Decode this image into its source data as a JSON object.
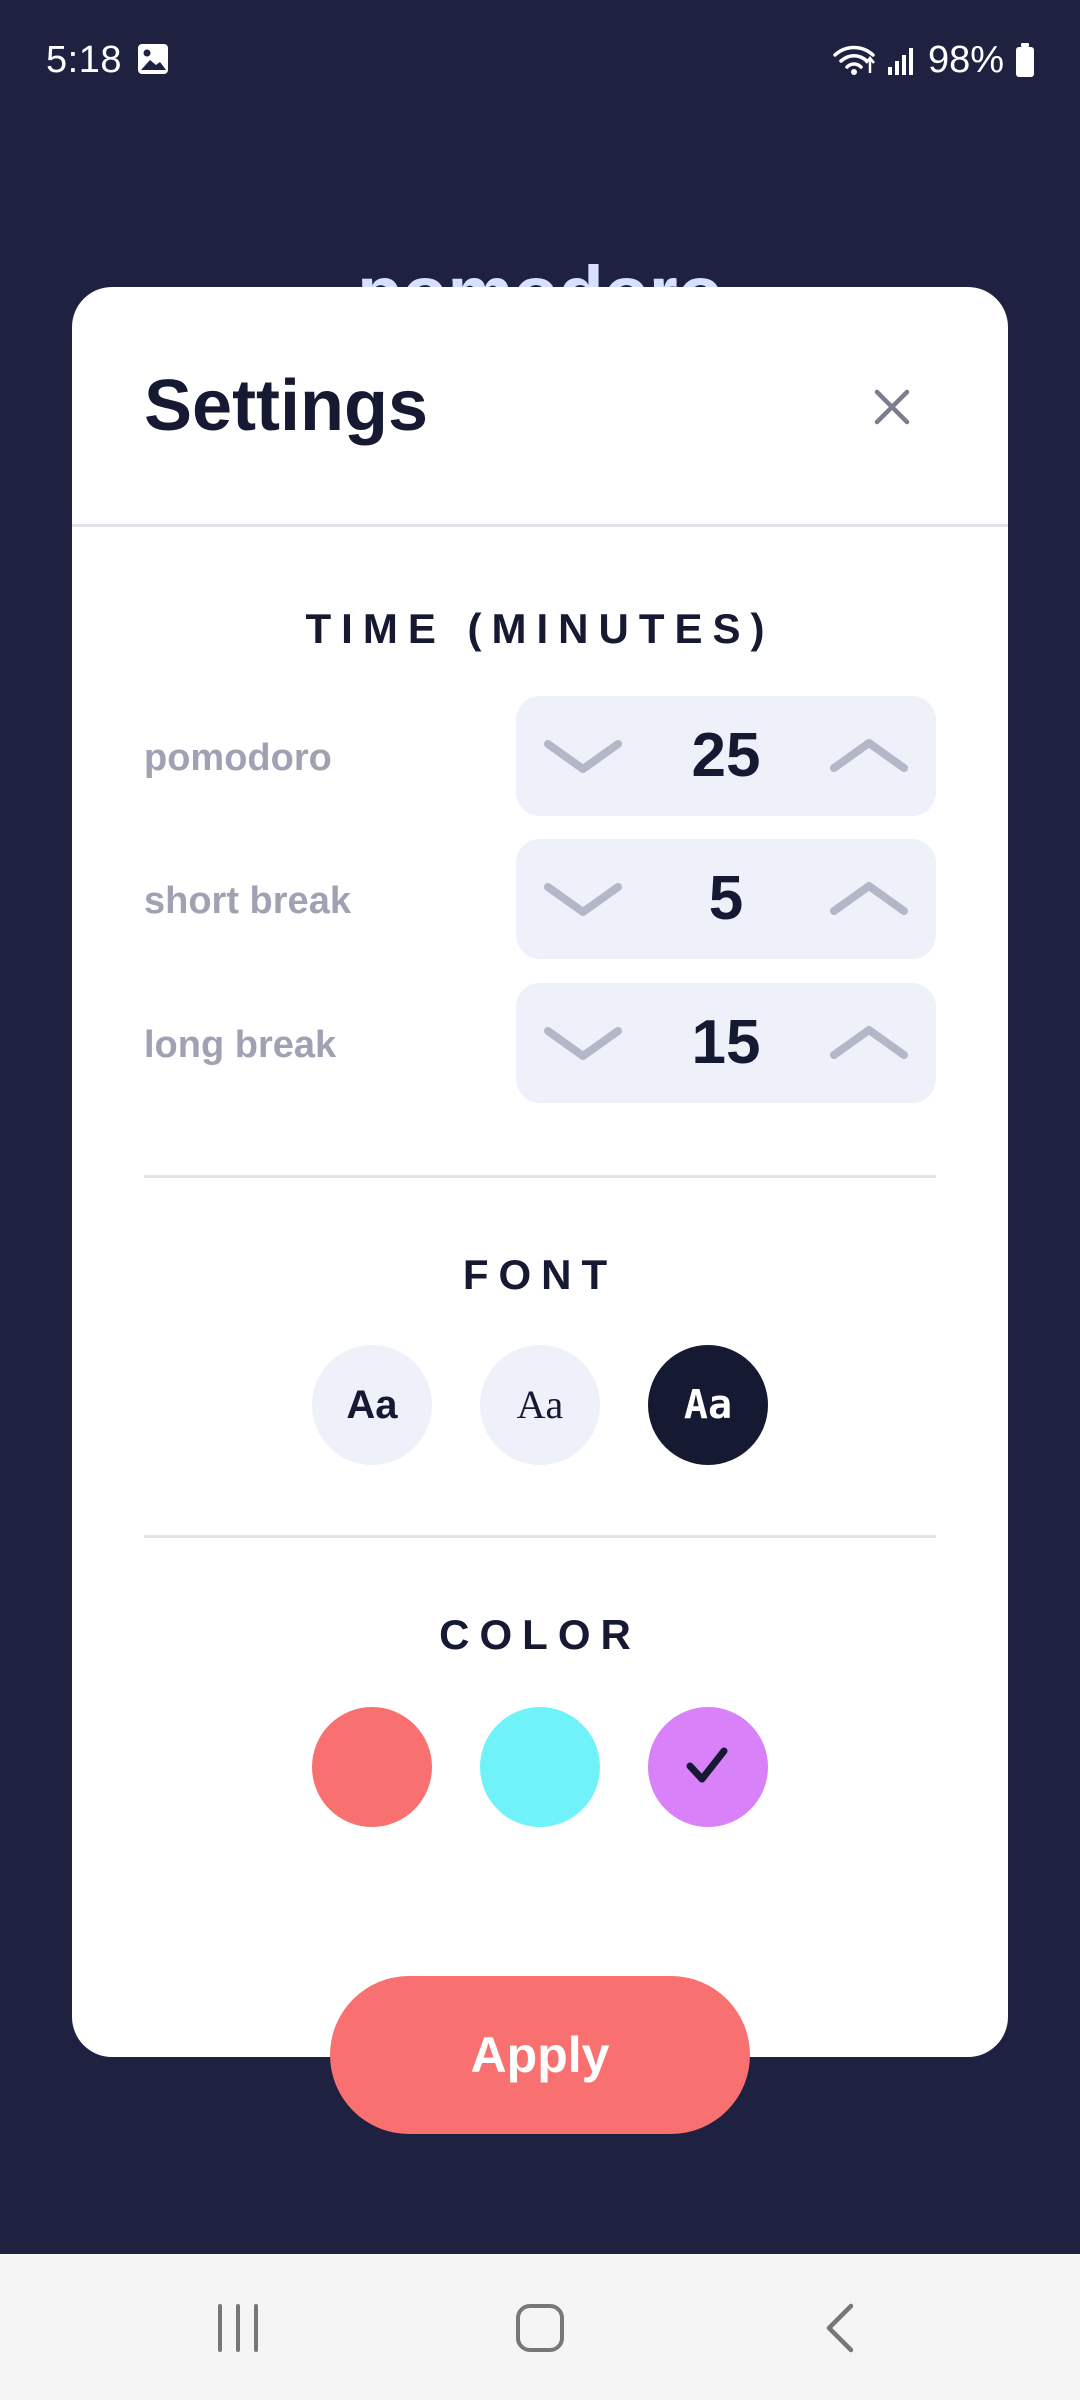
{
  "status_bar": {
    "time": "5:18",
    "battery": "98%",
    "icons": [
      "gallery-icon",
      "wifi-icon",
      "signal-icon",
      "battery-icon"
    ]
  },
  "background": {
    "title": "pomodoro",
    "color": "#1f2141"
  },
  "settings": {
    "title": "Settings",
    "close_icon": "close-icon",
    "time_section": {
      "heading": "TIME (MINUTES)",
      "rows": [
        {
          "label": "pomodoro",
          "value": "25"
        },
        {
          "label": "short break",
          "value": "5"
        },
        {
          "label": "long break",
          "value": "15"
        }
      ]
    },
    "font_section": {
      "heading": "FONT",
      "options": [
        {
          "label": "Aa",
          "selected": false
        },
        {
          "label": "Aa",
          "selected": false
        },
        {
          "label": "Aa",
          "selected": true
        }
      ]
    },
    "color_section": {
      "heading": "COLOR",
      "options": [
        {
          "color": "#f87070",
          "selected": false
        },
        {
          "color": "#70f3f8",
          "selected": false
        },
        {
          "color": "#d881f8",
          "selected": true
        }
      ]
    },
    "apply_label": "Apply"
  },
  "navigation": {
    "icons": [
      "recent-apps-icon",
      "home-icon",
      "back-icon"
    ]
  }
}
